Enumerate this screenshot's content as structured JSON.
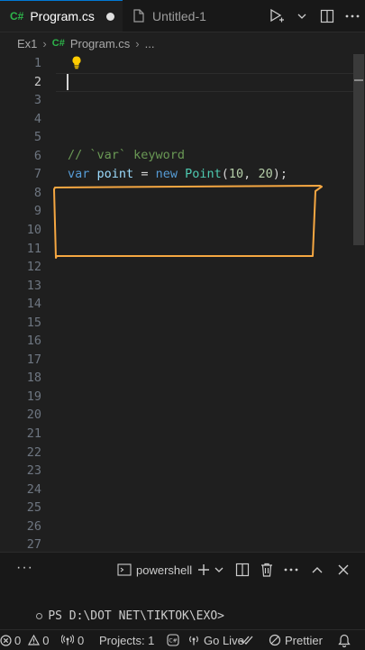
{
  "tabs": {
    "active": {
      "lang_badge": "C#",
      "label": "Program.cs"
    },
    "inactive": {
      "label": "Untitled-1"
    }
  },
  "breadcrumb": {
    "folder": "Ex1",
    "lang_badge": "C#",
    "file": "Program.cs",
    "more": "..."
  },
  "editor": {
    "line_numbers": [
      "1",
      "2",
      "3",
      "4",
      "5",
      "6",
      "7",
      "8",
      "9",
      "10",
      "11",
      "12",
      "13",
      "14",
      "15",
      "16",
      "17",
      "18",
      "19",
      "20",
      "21",
      "22",
      "23",
      "24",
      "25",
      "26",
      "27"
    ],
    "current_line": 2,
    "code": {
      "line7_comment": "// `var` keyword",
      "line8": {
        "kw1": "var",
        "ident": "point",
        "op": "=",
        "kw2": "new",
        "type": "Point",
        "open": "(",
        "n1": "10",
        "comma": ",",
        "n2": "20",
        "close": ");"
      }
    },
    "annotation_color": "#f5a742"
  },
  "panel": {
    "more_label": "···",
    "terminal_label": "powershell",
    "prompt": "PS D:\\DOT NET\\TIKTOK\\EXO>"
  },
  "status": {
    "errors": "0",
    "warnings": "0",
    "ports": "0",
    "projects": "Projects: 1",
    "go_live": "Go Live",
    "prettier": "Prettier"
  },
  "colors": {
    "accent": "#0078d4",
    "cs_green": "#2db54a"
  }
}
